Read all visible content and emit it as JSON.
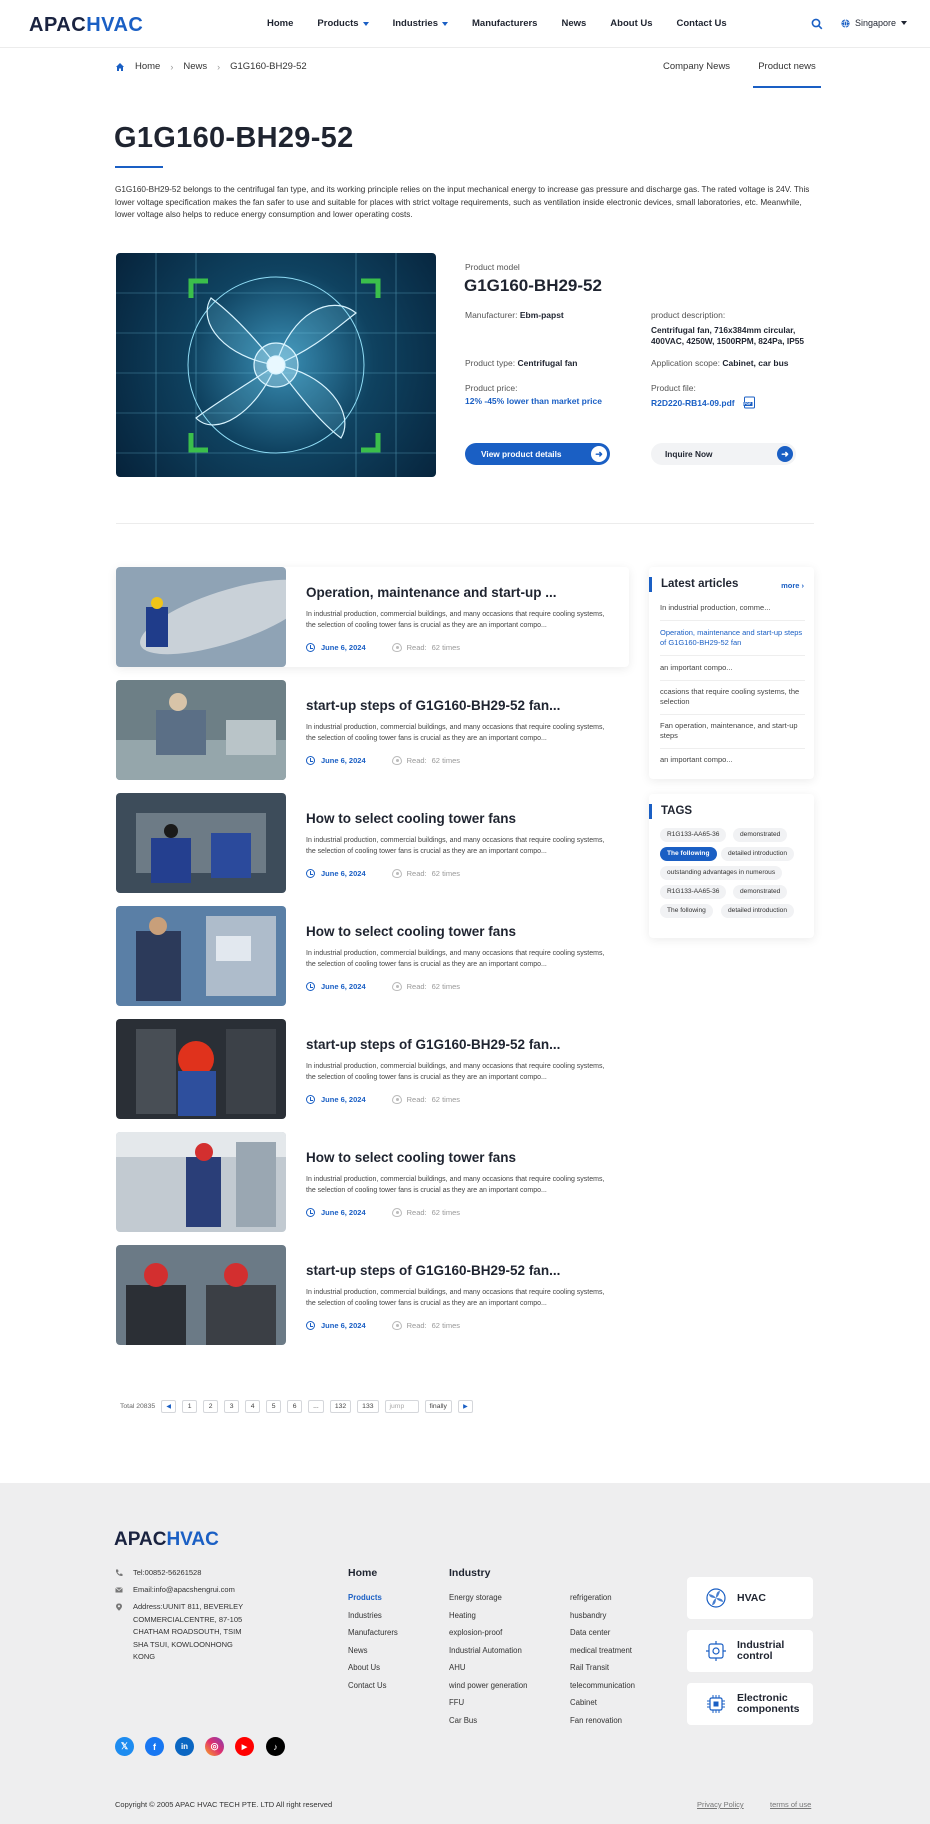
{
  "header": {
    "logo_a": "APAC",
    "logo_b": "HVAC",
    "nav": [
      "Home",
      "Products",
      "Industries",
      "Manufacturers",
      "News",
      "About Us",
      "Contact Us"
    ],
    "region": "Singapore"
  },
  "breadcrumb": {
    "home": "Home",
    "news": "News",
    "current": "G1G160-BH29-52"
  },
  "subtabs": {
    "company": "Company News",
    "product": "Product news"
  },
  "page": {
    "title": "G1G160-BH29-52",
    "intro": "G1G160-BH29-52 belongs to the centrifugal fan type, and its working principle relies on the input mechanical energy to increase gas pressure and discharge gas. The rated voltage is 24V. This lower voltage specification makes the fan safer to use and suitable for places with strict voltage requirements, such as ventilation inside electronic devices, small laboratories, etc. Meanwhile, lower voltage also helps to reduce energy consumption and lower operating costs."
  },
  "product": {
    "model_label": "Product model",
    "model": "G1G160-BH29-52",
    "manufacturer_label": "Manufacturer:",
    "manufacturer": "Ebm-papst",
    "description_label": "product description:",
    "description": "Centrifugal fan, 716x384mm circular, 400VAC, 4250W, 1500RPM, 824Pa, IP55",
    "type_label": "Product type:",
    "type": "Centrifugal fan",
    "scope_label": "Application scope:",
    "scope": "Cabinet, car bus",
    "price_label": "Product price:",
    "price": "12% -45% lower than market price",
    "file_label": "Product file:",
    "file": "R2D220-RB14-09.pdf",
    "view_button": "View product details",
    "inquire_button": "Inquire Now"
  },
  "articles": [
    {
      "title": "Operation, maintenance and start-up ...",
      "excerpt": "In industrial production, commercial buildings, and many occasions that require cooling systems, the selection of cooling tower fans is crucial as they are an important compo...",
      "date": "June 6, 2024",
      "read_label": "Read:",
      "read_count": "62 times"
    },
    {
      "title": "start-up steps of G1G160-BH29-52 fan...",
      "excerpt": "In industrial production, commercial buildings, and many occasions that require cooling systems, the selection of cooling tower fans is crucial as they are an important compo...",
      "date": "June 6, 2024",
      "read_label": "Read:",
      "read_count": "62 times"
    },
    {
      "title": "How to select cooling tower fans",
      "excerpt": "In industrial production, commercial buildings, and many occasions that require cooling systems, the selection of cooling tower fans is crucial as they are an important compo...",
      "date": "June 6, 2024",
      "read_label": "Read:",
      "read_count": "62 times"
    },
    {
      "title": "How to select cooling tower fans",
      "excerpt": "In industrial production, commercial buildings, and many occasions that require cooling systems, the selection of cooling tower fans is crucial as they are an important compo...",
      "date": "June 6, 2024",
      "read_label": "Read:",
      "read_count": "62 times"
    },
    {
      "title": "start-up steps of G1G160-BH29-52 fan...",
      "excerpt": "In industrial production, commercial buildings, and many occasions that require cooling systems, the selection of cooling tower fans is crucial as they are an important compo...",
      "date": "June 6, 2024",
      "read_label": "Read:",
      "read_count": "62 times"
    },
    {
      "title": "How to select cooling tower fans",
      "excerpt": "In industrial production, commercial buildings, and many occasions that require cooling systems, the selection of cooling tower fans is crucial as they are an important compo...",
      "date": "June 6, 2024",
      "read_label": "Read:",
      "read_count": "62 times"
    },
    {
      "title": "start-up steps of G1G160-BH29-52 fan...",
      "excerpt": "In industrial production, commercial buildings, and many occasions that require cooling systems, the selection of cooling tower fans is crucial as they are an important compo...",
      "date": "June 6, 2024",
      "read_label": "Read:",
      "read_count": "62 times"
    }
  ],
  "sidebar": {
    "latest_title": "Latest articles",
    "more": "more",
    "latest": [
      "In industrial production, comme...",
      "Operation, maintenance and start-up steps of G1G160-BH29-52 fan",
      "an important compo...",
      "ccasions that require cooling systems, the selection",
      "Fan operation, maintenance, and start-up steps",
      "an important compo..."
    ],
    "tags_title": "TAGS",
    "tags": [
      "R1G133-AA65-36",
      "demonstrated",
      "The following",
      "detailed introduction",
      "outstanding advantages in numerous",
      "R1G133-AA65-36",
      "demonstrated",
      "The following",
      "detailed introduction"
    ]
  },
  "pagination": {
    "total": "Total 20835",
    "pages": [
      "1",
      "2",
      "3",
      "4",
      "5",
      "6",
      "...",
      "132",
      "133"
    ],
    "jump_placeholder": "jump",
    "finally": "finally"
  },
  "footer": {
    "logo_a": "APAC",
    "logo_b": "HVAC",
    "tel": "Tel:00852-56261528",
    "email": "Email:info@apacshengrui.com",
    "address": "Address:UUNIT 811, BEVERLEY COMMERCIALCENTRE, 87-105 CHATHAM ROADSOUTH, TSIM SHA TSUI, KOWLOONHONG KONG",
    "home_title": "Home",
    "home_links": [
      "Products",
      "Industries",
      "Manufacturers",
      "News",
      "About Us",
      "Contact Us"
    ],
    "industry_title": "Industry",
    "industry_col1": [
      "Energy storage",
      "Heating",
      "explosion-proof",
      "Industrial Automation",
      "AHU",
      "wind power generation",
      "FFU",
      "Car Bus"
    ],
    "industry_col2": [
      "refrigeration",
      "husbandry",
      "Data center",
      "medical treatment",
      "Rail Transit",
      "telecommunication",
      "Cabinet",
      "Fan renovation"
    ],
    "cards": [
      "HVAC",
      "Industrial control",
      "Electronic components"
    ],
    "copyright": "Copyright © 2005 APAC HVAC TECH PTE. LTD All right reserved",
    "privacy": "Privacy Policy",
    "terms": "terms of use"
  },
  "colors": {
    "brand": "#1a5fc4",
    "dark": "#1f2430",
    "footer_bg": "#eeeeef"
  }
}
